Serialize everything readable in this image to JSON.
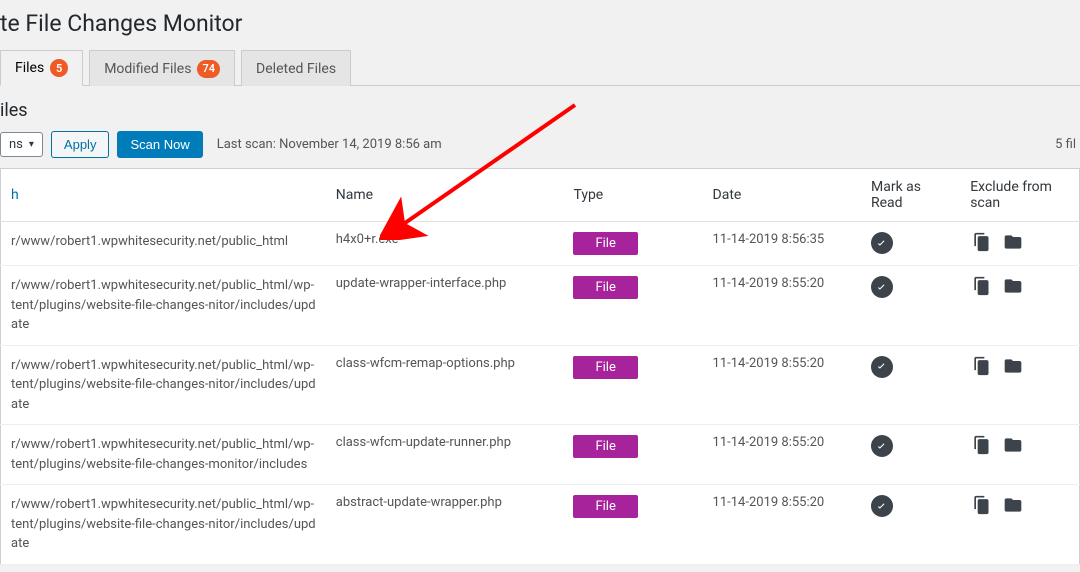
{
  "page": {
    "title": "te File Changes Monitor"
  },
  "tabs": [
    {
      "label": "Files",
      "count": "5",
      "active": true
    },
    {
      "label": "Modified Files",
      "count": "74",
      "active": false
    },
    {
      "label": "Deleted Files",
      "count": "",
      "active": false
    }
  ],
  "section_title": "iles",
  "actions": {
    "select_label": "ns",
    "apply_label": "Apply",
    "scan_label": "Scan Now",
    "last_scan_prefix": "Last scan: ",
    "last_scan_value": "November 14, 2019 8:56 am",
    "count_text": "5 fil"
  },
  "columns": {
    "path": "h",
    "name": "Name",
    "type": "Type",
    "date": "Date",
    "mark": "Mark as Read",
    "exclude": "Exclude from scan"
  },
  "type_badge_label": "File",
  "rows": [
    {
      "path": "r/www/robert1.wpwhitesecurity.net/public_html",
      "name": "h4x0+r.exe",
      "date": "11-14-2019 8:56:35"
    },
    {
      "path": "r/www/robert1.wpwhitesecurity.net/public_html/wp-tent/plugins/website-file-changes-nitor/includes/update",
      "name": "update-wrapper-interface.php",
      "date": "11-14-2019 8:55:20"
    },
    {
      "path": "r/www/robert1.wpwhitesecurity.net/public_html/wp-tent/plugins/website-file-changes-nitor/includes/update",
      "name": "class-wfcm-remap-options.php",
      "date": "11-14-2019 8:55:20"
    },
    {
      "path": "r/www/robert1.wpwhitesecurity.net/public_html/wp-tent/plugins/website-file-changes-monitor/includes",
      "name": "class-wfcm-update-runner.php",
      "date": "11-14-2019 8:55:20"
    },
    {
      "path": "r/www/robert1.wpwhitesecurity.net/public_html/wp-tent/plugins/website-file-changes-nitor/includes/update",
      "name": "abstract-update-wrapper.php",
      "date": "11-14-2019 8:55:20"
    }
  ],
  "arrow_color": "#ff0000"
}
